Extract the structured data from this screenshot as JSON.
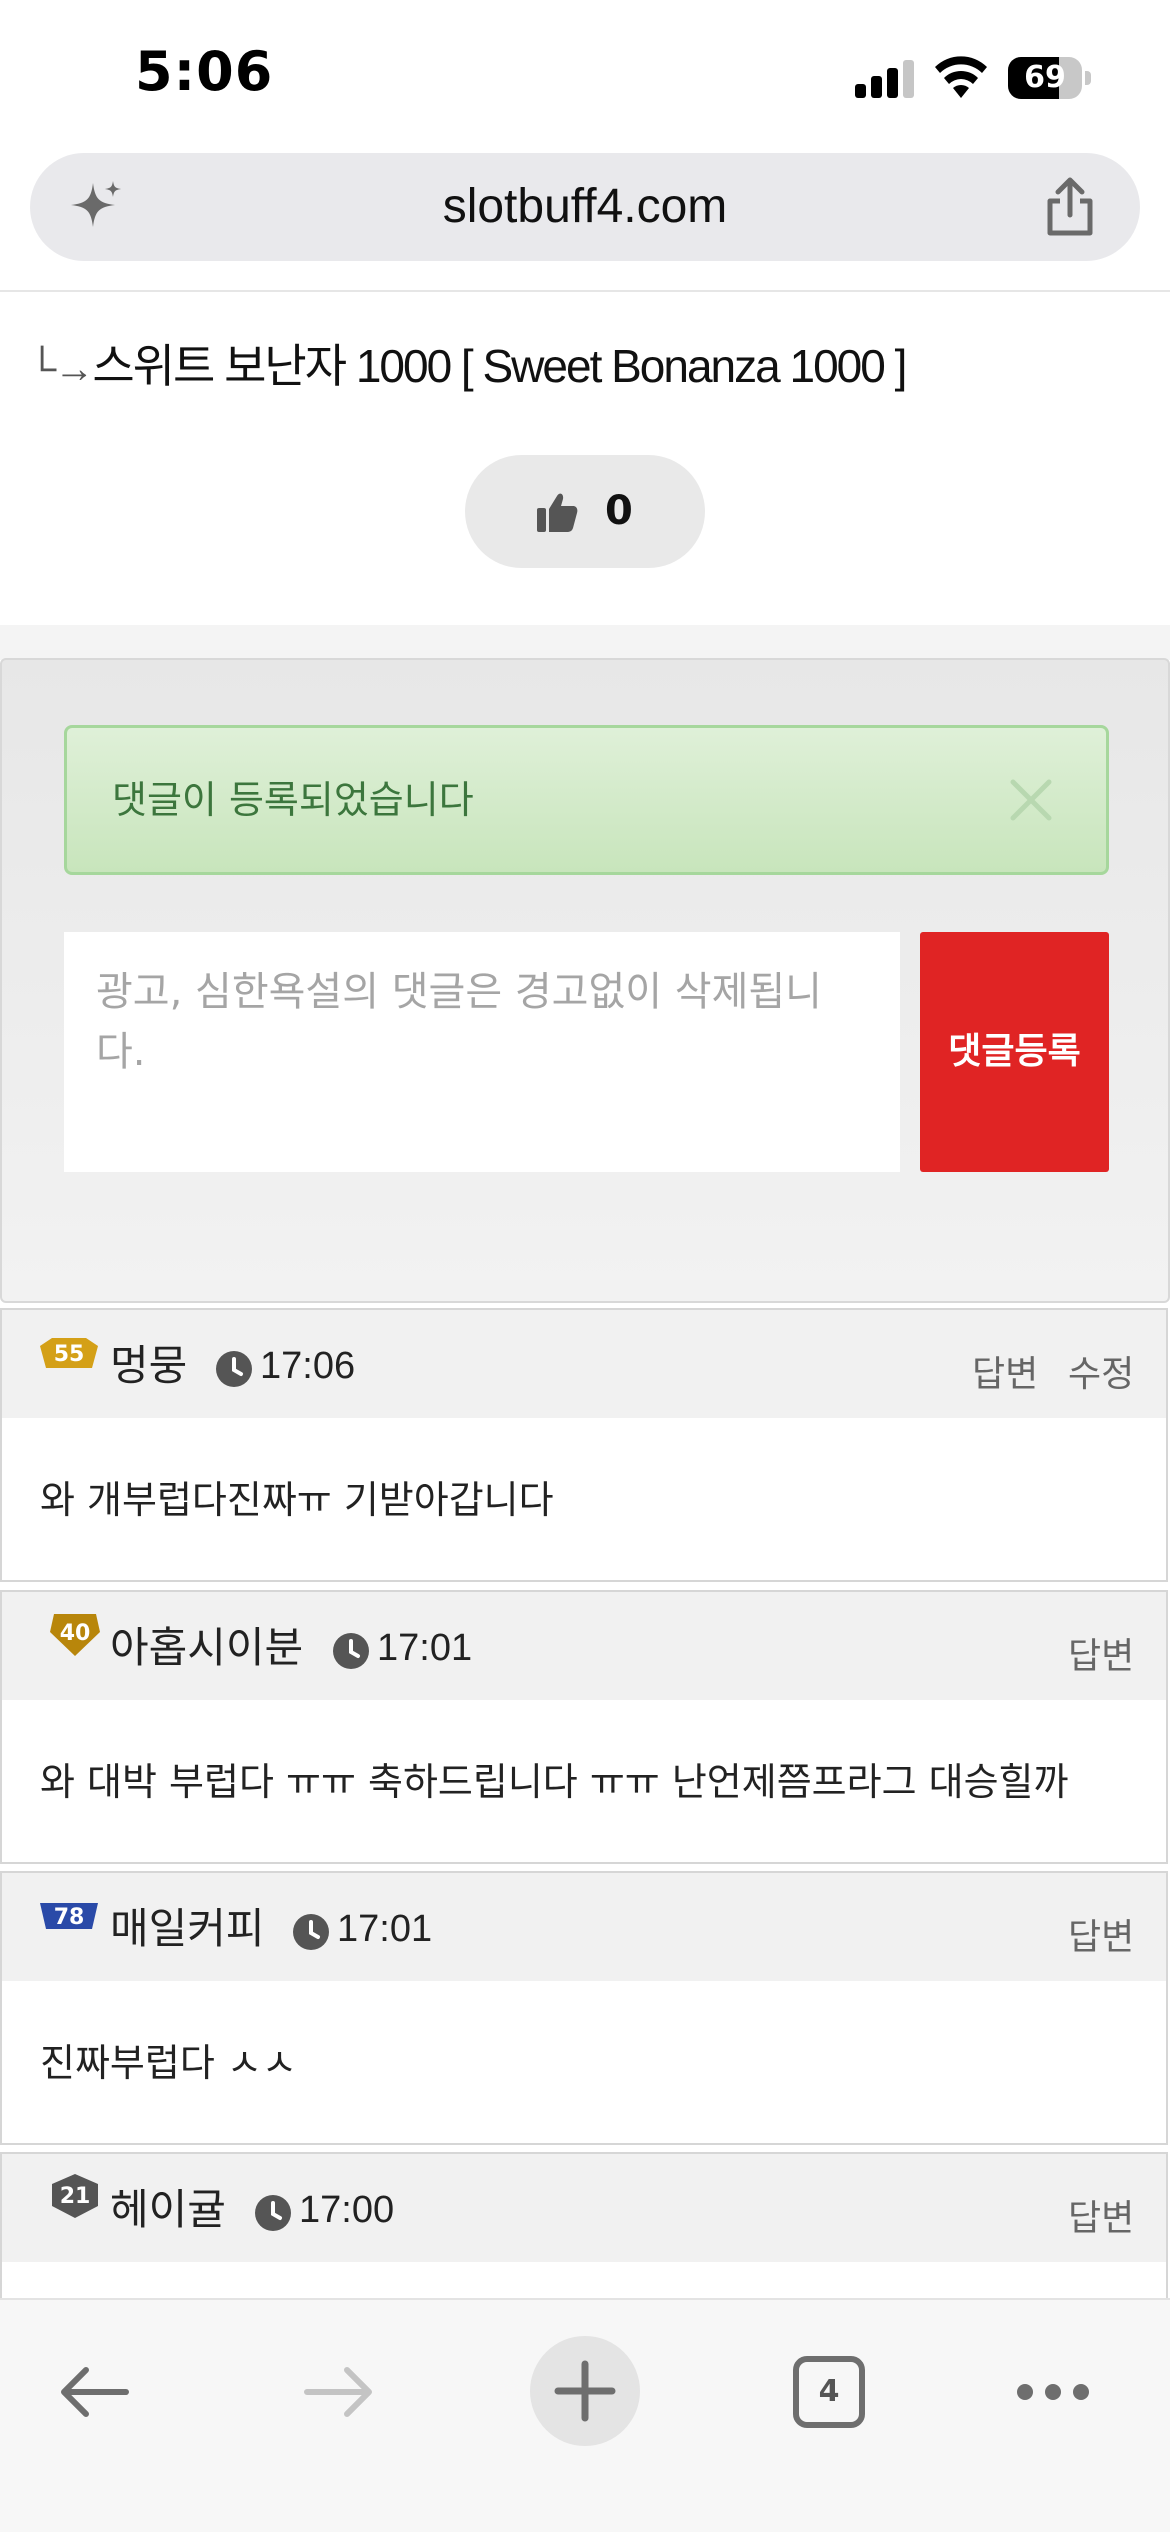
{
  "status_bar": {
    "time": "5:06",
    "battery": "69",
    "battery_level": 0.69
  },
  "browser": {
    "url": "slotbuff4.com",
    "tab_count": "4"
  },
  "post": {
    "title_arrow": "└→",
    "title": "스위트 보난자 1000 [ Sweet Bonanza 1000 ]",
    "like_count": "0"
  },
  "comment_form": {
    "alert_text": "댓글이 등록되었습니다",
    "placeholder": "광고, 심한욕설의 댓글은 경고없이 삭제됩니다.",
    "placeholder_line1": "광고, 심한욕설의 댓글은 경고없이 삭제됩니",
    "placeholder_line2": "다.",
    "submit_label": "댓글등록"
  },
  "comments": [
    {
      "level": "55",
      "author": "멍뭉",
      "time": "17:06",
      "body": "와 개부럽다진짜ㅠ 기받아갑니다",
      "reply_label": "답변",
      "edit_label": "수정",
      "badge_color": "#d4a017"
    },
    {
      "level": "40",
      "author": "아홉시이분",
      "time": "17:01",
      "body": "와 대박 부럽다 ㅠㅠ 축하드립니다 ㅠㅠ 난언제쯤프라그 대승힐까",
      "reply_label": "답변",
      "badge_color": "#b8860b"
    },
    {
      "level": "78",
      "author": "매일커피",
      "time": "17:01",
      "body": "진짜부럽다 ㅅㅅ",
      "reply_label": "답변",
      "badge_color": "#2a4aa8"
    },
    {
      "level": "21",
      "author": "헤이귤",
      "time": "17:00",
      "body": "",
      "reply_label": "답변",
      "badge_color": "#555555"
    }
  ]
}
